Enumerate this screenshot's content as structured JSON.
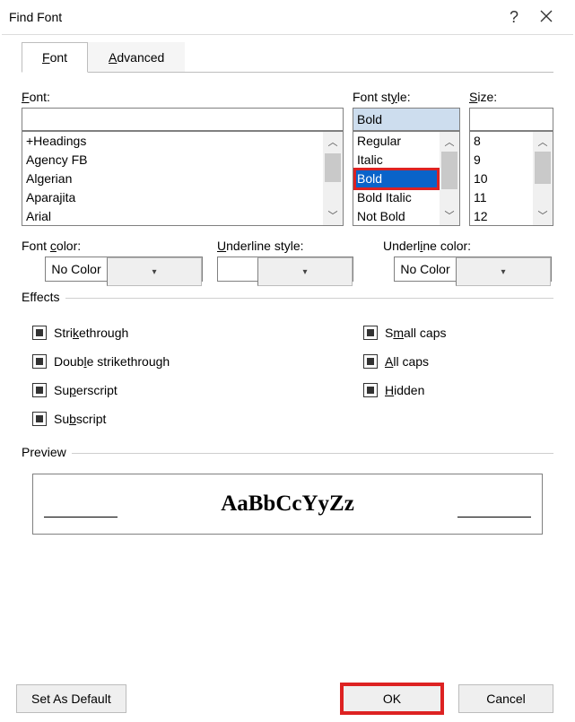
{
  "window": {
    "title": "Find Font"
  },
  "tabs": {
    "font": "Font",
    "advanced": "Advanced"
  },
  "font": {
    "label": "Font:",
    "value": "",
    "items": [
      "+Headings",
      "Agency FB",
      "Algerian",
      "Aparajita",
      "Arial"
    ]
  },
  "style": {
    "label": "Font style:",
    "value": "Bold",
    "items": [
      "Regular",
      "Italic",
      "Bold",
      "Bold Italic",
      "Not Bold"
    ],
    "selected_index": 2
  },
  "size": {
    "label": "Size:",
    "value": "",
    "items": [
      "8",
      "9",
      "10",
      "11",
      "12"
    ]
  },
  "font_color": {
    "label": "Font color:",
    "value": "No Color"
  },
  "underline_style": {
    "label": "Underline style:",
    "value": ""
  },
  "underline_color": {
    "label": "Underline color:",
    "value": "No Color"
  },
  "effects": {
    "legend": "Effects",
    "left": [
      "Strikethrough",
      "Double strikethrough",
      "Superscript",
      "Subscript"
    ],
    "right": [
      "Small caps",
      "All caps",
      "Hidden"
    ]
  },
  "preview": {
    "legend": "Preview",
    "text": "AaBbCcYyZz"
  },
  "buttons": {
    "default": "Set As Default",
    "ok": "OK",
    "cancel": "Cancel"
  }
}
